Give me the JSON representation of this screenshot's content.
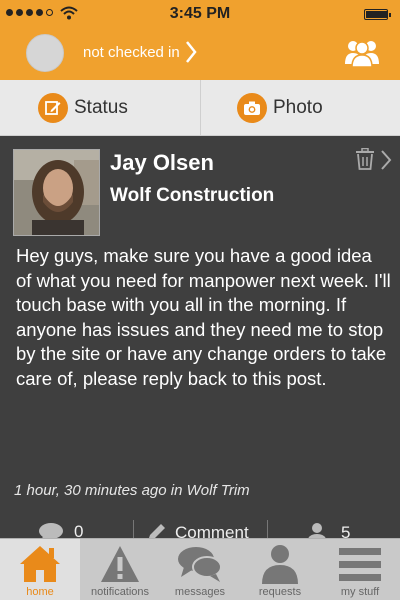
{
  "status_bar": {
    "time": "3:45 PM",
    "signal_dots_filled": 4,
    "signal_dots_total": 5,
    "battery_level": 0.95
  },
  "header": {
    "checkin_label": "not checked in"
  },
  "actions": {
    "status_label": "Status",
    "photo_label": "Photo"
  },
  "post": {
    "author": "Jay Olsen",
    "company": "Wolf Construction",
    "body": "Hey guys, make sure you have a good idea of what you need for manpower next week. I'll touch base with you all in the morning. If anyone has issues and they need me to stop by the site or have any change orders to take care of, please reply back to this post.",
    "meta": "1 hour, 30 minutes ago in Wolf Trim",
    "comment_count": "0",
    "comment_label": "Comment",
    "people_count": "5"
  },
  "tabs": [
    {
      "label": "home",
      "icon": "home-icon",
      "active": true
    },
    {
      "label": "notifications",
      "icon": "warning-icon",
      "active": false
    },
    {
      "label": "messages",
      "icon": "chat-bubbles-icon",
      "active": false
    },
    {
      "label": "requests",
      "icon": "person-icon",
      "active": false
    },
    {
      "label": "my stuff",
      "icon": "menu-icon",
      "active": false
    }
  ],
  "colors": {
    "accent": "#f0a12e",
    "accent_dark": "#e98a1a",
    "post_bg": "#3f3f3f",
    "action_bar_bg": "#e9e9e9",
    "tab_bar_bg": "#c9c9c9"
  }
}
